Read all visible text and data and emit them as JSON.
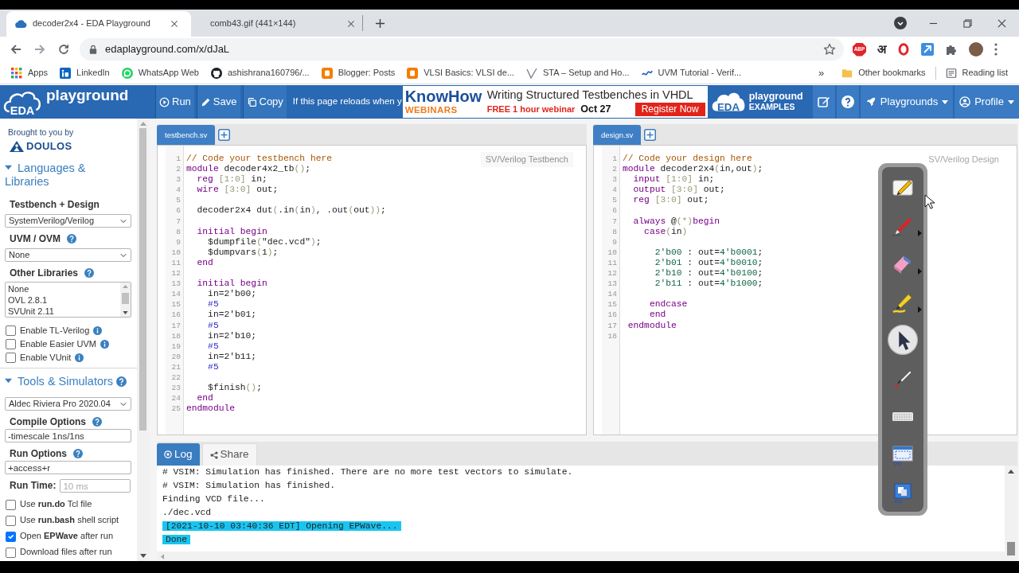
{
  "browser": {
    "tabs": [
      {
        "title": "decoder2x4 - EDA Playground",
        "favicon": true,
        "selected": true
      },
      {
        "title": "comb43.gif (441×144)",
        "favicon": false,
        "selected": false
      }
    ],
    "address": "edaplayground.com/x/dJaL",
    "extensions": {
      "stop_badge": "ABP",
      "script_letter": "अ"
    },
    "bookmarks": [
      {
        "label": "Apps"
      },
      {
        "label": "LinkedIn"
      },
      {
        "label": "WhatsApp Web"
      },
      {
        "label": "ashishrana160796/..."
      },
      {
        "label": "Blogger: Posts"
      },
      {
        "label": "VLSI Basics: VLSI de..."
      },
      {
        "label": "STA – Setup and Ho..."
      },
      {
        "label": "UVM Tutorial - Verif..."
      }
    ],
    "bookmarks_overflow": "»",
    "other_bookmarks": "Other bookmarks",
    "reading_list": "Reading list"
  },
  "toolbar": {
    "logo_badge": "EDA",
    "logo_word": "playground",
    "buttons": [
      "Run",
      "Save",
      "Copy"
    ],
    "notice": "If this page reloads when y",
    "ad": {
      "brand": "KnowHow",
      "brand_sub": "WEBINARS",
      "headline": "Writing Structured Testbenches in VHDL",
      "offer": "FREE 1 hour webinar",
      "date": "Oct 27",
      "cta": "Register Now"
    },
    "examples": {
      "badge": "EDA",
      "title": "playground",
      "subtitle": "EXAMPLES"
    },
    "menus": [
      "Playgrounds",
      "Profile"
    ]
  },
  "sidebar": {
    "credit": "Brought to you by",
    "sponsor": "DOULOS",
    "sections": [
      {
        "title": "Languages & Libraries",
        "expanded": true,
        "help": false,
        "items": [
          {
            "kind": "heading",
            "text": "Testbench + Design",
            "help": false
          },
          {
            "kind": "select",
            "value": "SystemVerilog/Verilog"
          },
          {
            "kind": "heading",
            "text": "UVM / OVM",
            "help": true
          },
          {
            "kind": "select",
            "value": "None"
          },
          {
            "kind": "heading",
            "text": "Other Libraries",
            "help": true
          },
          {
            "kind": "listbox",
            "options": [
              "None",
              "OVL 2.8.1",
              "SVUnit 2.11"
            ]
          }
        ],
        "checkboxes": [
          {
            "text": "Enable TL-Verilog",
            "checked": false,
            "info": true
          },
          {
            "text": "Enable Easier UVM",
            "checked": false,
            "info": true
          },
          {
            "text": "Enable VUnit",
            "checked": false,
            "info": true
          }
        ]
      },
      {
        "title": "Tools & Simulators",
        "expanded": true,
        "help": true,
        "items": [
          {
            "kind": "select",
            "value": "Aldec Riviera Pro 2020.04"
          },
          {
            "kind": "heading",
            "text": "Compile Options",
            "help": true
          },
          {
            "kind": "input",
            "value": "-timescale 1ns/1ns"
          },
          {
            "kind": "heading",
            "text": "Run Options",
            "help": true
          },
          {
            "kind": "input",
            "value": "+access+r"
          },
          {
            "kind": "labeled-input",
            "text": "Run Time:",
            "placeholder": "10 ms"
          }
        ],
        "checkboxes": [
          {
            "text": "Use **run.do** Tcl file",
            "checked": false,
            "info": false
          },
          {
            "text": "Use **run.bash** shell script",
            "checked": false,
            "info": false
          },
          {
            "text": "Open **EPWave** after run",
            "checked": true,
            "info": false
          },
          {
            "text": "Download files after run",
            "checked": false,
            "info": false
          }
        ]
      }
    ]
  },
  "editors": [
    {
      "tab": {
        "label": "testbench.sv",
        "selected": true
      },
      "mode": "SV/Verilog Testbench",
      "faded": false,
      "lines": [
        {
          "number": "1",
          "tokens": [
            {
              "kind": "comment",
              "text": "// Code your testbench here"
            }
          ]
        },
        {
          "number": "2",
          "tokens": [
            {
              "kind": "keyword",
              "text": "module"
            },
            {
              "kind": "plain",
              "text": " decoder4x2_tb"
            },
            {
              "kind": "bracket",
              "text": "()"
            },
            {
              "kind": "plain",
              "text": ";"
            }
          ]
        },
        {
          "number": "3",
          "tokens": [
            {
              "kind": "keyword",
              "text": "  reg"
            },
            {
              "kind": "bracket",
              "text": " [1:0]"
            },
            {
              "kind": "plain",
              "text": " in;"
            }
          ]
        },
        {
          "number": "4",
          "tokens": [
            {
              "kind": "keyword",
              "text": "  wire"
            },
            {
              "kind": "bracket",
              "text": " [3:0]"
            },
            {
              "kind": "plain",
              "text": " out;"
            }
          ]
        },
        {
          "number": "5"
        },
        {
          "number": "6",
          "tokens": [
            {
              "kind": "plain",
              "text": "  decoder2x4 dut"
            },
            {
              "kind": "bracket",
              "text": "("
            },
            {
              "kind": "plain",
              "text": ".in"
            },
            {
              "kind": "bracket",
              "text": "("
            },
            {
              "kind": "plain",
              "text": "in"
            },
            {
              "kind": "bracket",
              "text": ")"
            },
            {
              "kind": "plain",
              "text": ", .out"
            },
            {
              "kind": "bracket",
              "text": "("
            },
            {
              "kind": "plain",
              "text": "out"
            },
            {
              "kind": "bracket",
              "text": "))"
            },
            {
              "kind": "plain",
              "text": ";"
            }
          ]
        },
        {
          "number": "7"
        },
        {
          "number": "8",
          "tokens": [
            {
              "kind": "keyword",
              "text": "  initial begin"
            }
          ]
        },
        {
          "number": "9",
          "tokens": [
            {
              "kind": "plain",
              "text": "    $dumpfile"
            },
            {
              "kind": "bracket",
              "text": "("
            },
            {
              "kind": "plain",
              "text": "\"dec.vcd\""
            },
            {
              "kind": "bracket",
              "text": ")"
            },
            {
              "kind": "plain",
              "text": ";"
            }
          ]
        },
        {
          "number": "10",
          "tokens": [
            {
              "kind": "plain",
              "text": "    $dumpvars"
            },
            {
              "kind": "bracket",
              "text": "("
            },
            {
              "kind": "plain",
              "text": "1"
            },
            {
              "kind": "bracket",
              "text": ")"
            },
            {
              "kind": "plain",
              "text": ";"
            }
          ]
        },
        {
          "number": "11",
          "tokens": [
            {
              "kind": "keyword",
              "text": "  end"
            }
          ]
        },
        {
          "number": "12"
        },
        {
          "number": "13",
          "tokens": [
            {
              "kind": "keyword",
              "text": "  initial begin"
            }
          ]
        },
        {
          "number": "14",
          "tokens": [
            {
              "kind": "plain",
              "text": "    in=2'b00;"
            }
          ]
        },
        {
          "number": "15",
          "tokens": [
            {
              "kind": "delay",
              "text": "    #5"
            }
          ]
        },
        {
          "number": "16",
          "tokens": [
            {
              "kind": "plain",
              "text": "    in=2'b01;"
            }
          ]
        },
        {
          "number": "17",
          "tokens": [
            {
              "kind": "delay",
              "text": "    #5"
            }
          ]
        },
        {
          "number": "18",
          "tokens": [
            {
              "kind": "plain",
              "text": "    in=2'b10;"
            }
          ]
        },
        {
          "number": "19",
          "tokens": [
            {
              "kind": "delay",
              "text": "    #5"
            }
          ]
        },
        {
          "number": "20",
          "tokens": [
            {
              "kind": "plain",
              "text": "    in=2'b11;"
            }
          ]
        },
        {
          "number": "21",
          "tokens": [
            {
              "kind": "delay",
              "text": "    #5"
            }
          ]
        },
        {
          "number": "22"
        },
        {
          "number": "23",
          "tokens": [
            {
              "kind": "plain",
              "text": "    $finish"
            },
            {
              "kind": "bracket",
              "text": "()"
            },
            {
              "kind": "plain",
              "text": ";"
            }
          ]
        },
        {
          "number": "24",
          "tokens": [
            {
              "kind": "keyword",
              "text": "  end"
            }
          ]
        },
        {
          "number": "25",
          "tokens": [
            {
              "kind": "keyword",
              "text": "endmodule"
            }
          ]
        }
      ]
    },
    {
      "tab": {
        "label": "design.sv",
        "selected": true
      },
      "mode": "SV/Verilog Design",
      "faded": true,
      "lines": [
        {
          "number": "1",
          "tokens": [
            {
              "kind": "comment",
              "text": "// Code your design here"
            }
          ]
        },
        {
          "number": "2",
          "tokens": [
            {
              "kind": "keyword",
              "text": "module"
            },
            {
              "kind": "plain",
              "text": " decoder2x4"
            },
            {
              "kind": "bracket",
              "text": "("
            },
            {
              "kind": "plain",
              "text": "in,out"
            },
            {
              "kind": "bracket",
              "text": ")"
            },
            {
              "kind": "plain",
              "text": ";"
            }
          ]
        },
        {
          "number": "3",
          "tokens": [
            {
              "kind": "keyword",
              "text": "  input"
            },
            {
              "kind": "bracket",
              "text": " [1:0]"
            },
            {
              "kind": "plain",
              "text": " in;"
            }
          ]
        },
        {
          "number": "4",
          "tokens": [
            {
              "kind": "keyword",
              "text": "  output"
            },
            {
              "kind": "bracket",
              "text": " [3:0]"
            },
            {
              "kind": "plain",
              "text": " out;"
            }
          ]
        },
        {
          "number": "5",
          "tokens": [
            {
              "kind": "keyword",
              "text": "  reg"
            },
            {
              "kind": "bracket",
              "text": " [3:0]"
            },
            {
              "kind": "plain",
              "text": " out;"
            }
          ]
        },
        {
          "number": "6"
        },
        {
          "number": "7",
          "tokens": [
            {
              "kind": "keyword",
              "text": "  always"
            },
            {
              "kind": "plain",
              "text": " @"
            },
            {
              "kind": "bracket",
              "text": "(*)"
            },
            {
              "kind": "keyword",
              "text": "begin"
            }
          ]
        },
        {
          "number": "8",
          "tokens": [
            {
              "kind": "keyword",
              "text": "    case"
            },
            {
              "kind": "bracket",
              "text": "("
            },
            {
              "kind": "plain",
              "text": "in"
            },
            {
              "kind": "bracket",
              "text": ")"
            }
          ]
        },
        {
          "number": "9"
        },
        {
          "number": "10",
          "tokens": [
            {
              "kind": "number",
              "text": "      2'b00"
            },
            {
              "kind": "plain",
              "text": " : out="
            },
            {
              "kind": "number",
              "text": "4'b0001"
            },
            {
              "kind": "plain",
              "text": ";"
            }
          ]
        },
        {
          "number": "11",
          "tokens": [
            {
              "kind": "number",
              "text": "      2'b01"
            },
            {
              "kind": "plain",
              "text": " : out="
            },
            {
              "kind": "number",
              "text": "4'b0010"
            },
            {
              "kind": "plain",
              "text": ";"
            }
          ]
        },
        {
          "number": "12",
          "tokens": [
            {
              "kind": "number",
              "text": "      2'b10"
            },
            {
              "kind": "plain",
              "text": " : out="
            },
            {
              "kind": "number",
              "text": "4'b0100"
            },
            {
              "kind": "plain",
              "text": ";"
            }
          ]
        },
        {
          "number": "13",
          "tokens": [
            {
              "kind": "number",
              "text": "      2'b11"
            },
            {
              "kind": "plain",
              "text": " : out="
            },
            {
              "kind": "number",
              "text": "4'b1000"
            },
            {
              "kind": "plain",
              "text": ";"
            }
          ]
        },
        {
          "number": "14"
        },
        {
          "number": "15",
          "tokens": [
            {
              "kind": "keyword",
              "text": "     endcase"
            }
          ]
        },
        {
          "number": "16",
          "tokens": [
            {
              "kind": "keyword",
              "text": "     end"
            }
          ]
        },
        {
          "number": "17",
          "tokens": [
            {
              "kind": "keyword",
              "text": " endmodule"
            }
          ]
        },
        {
          "number": "18"
        }
      ]
    }
  ],
  "log": {
    "tabs": [
      {
        "label": "Log",
        "selected": true
      },
      {
        "label": "Share",
        "selected": false
      }
    ],
    "lines": [
      {
        "text": "# VSIM: Simulation has finished. There are no more test vectors to simulate.",
        "highlighted": false
      },
      {
        "text": "# VSIM: Simulation has finished.",
        "highlighted": false
      },
      {
        "text": "Finding VCD file...",
        "highlighted": false
      },
      {
        "text": "./dec.vcd",
        "highlighted": false
      },
      {
        "text": "[2021-10-10 03:40:36 EDT] Opening EPWave...",
        "highlighted": true
      },
      {
        "text": "Done",
        "highlighted": true
      }
    ]
  },
  "annotation_tools": [
    {
      "selected": false,
      "submenu": false
    },
    {
      "selected": false,
      "submenu": true
    },
    {
      "selected": false,
      "submenu": true
    },
    {
      "selected": false,
      "submenu": true
    },
    {
      "selected": true,
      "submenu": false
    },
    {
      "selected": false,
      "submenu": false
    },
    {
      "selected": false,
      "submenu": false
    },
    {
      "selected": false,
      "submenu": false
    },
    {
      "selected": false,
      "submenu": false
    }
  ]
}
